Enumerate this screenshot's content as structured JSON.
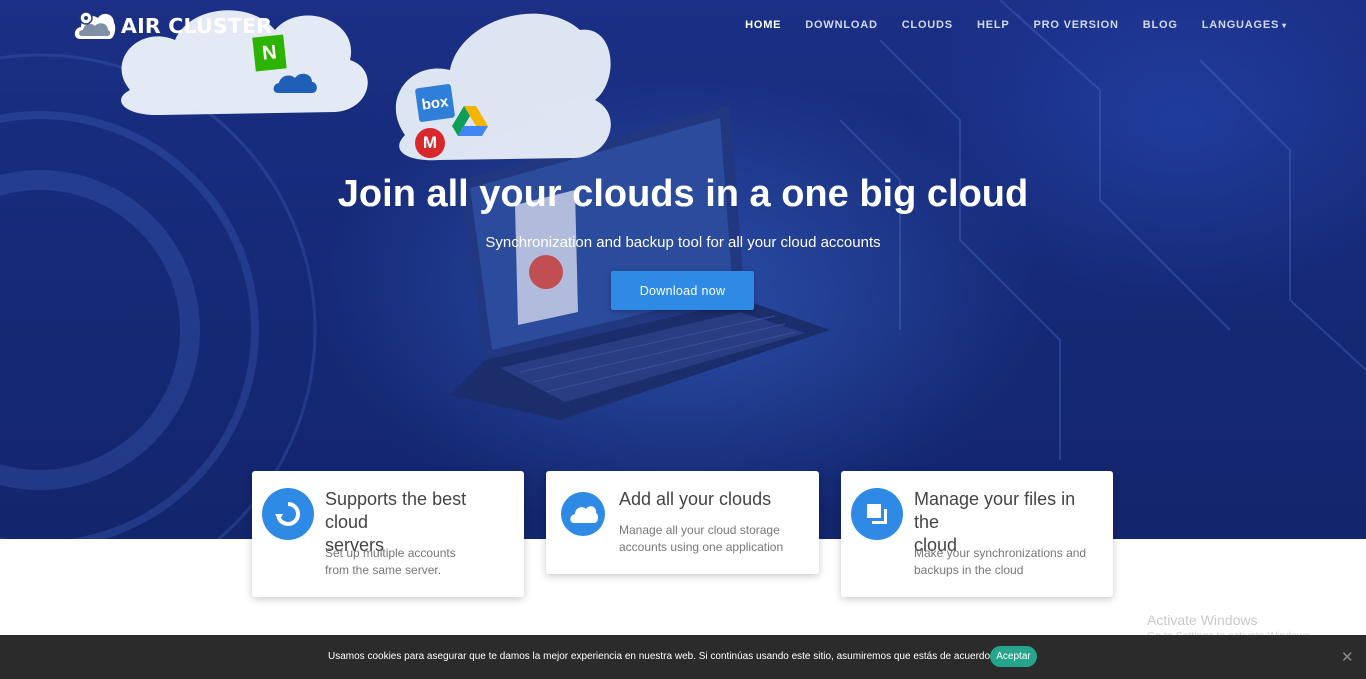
{
  "brand": {
    "name": "AIR CLUSTER",
    "logo_icon": "cloud-logo-icon"
  },
  "nav": {
    "items": [
      {
        "label": "HOME",
        "active": true
      },
      {
        "label": "DOWNLOAD",
        "active": false
      },
      {
        "label": "CLOUDS",
        "active": false
      },
      {
        "label": "HELP",
        "active": false
      },
      {
        "label": "PRO VERSION",
        "active": false
      },
      {
        "label": "BLOG",
        "active": false
      }
    ],
    "languages": {
      "label": "LANGUAGES",
      "caret": "▾"
    }
  },
  "hero": {
    "headline": "Join all your clouds in a one big cloud",
    "subheadline": "Synchronization and backup tool for all your cloud accounts",
    "cta_label": "Download now",
    "cloud_service_icons": [
      "naver-icon",
      "onedrive-icon",
      "box-icon",
      "google-drive-icon",
      "mega-icon"
    ],
    "box_text": "box",
    "naver_text": "N",
    "mega_text": "M"
  },
  "features": [
    {
      "icon": "refresh-circle-icon",
      "title_line1": "Supports the best cloud",
      "title_line2": "servers",
      "text_line1": "Set up multiple accounts",
      "text_line2": "from the same server."
    },
    {
      "icon": "cloud-icon",
      "title_line1": "Add all your clouds",
      "title_line2": "",
      "text_line1": "Manage all your cloud storage",
      "text_line2": "accounts using one application"
    },
    {
      "icon": "files-icon",
      "title_line1": "Manage your files in the",
      "title_line2": "cloud",
      "text_line1": "Make your synchronizations and",
      "text_line2": "backups in the cloud"
    }
  ],
  "os_watermark": {
    "title": "Activate Windows",
    "subtitle": "Go to Settings to activate Windows."
  },
  "cookie_banner": {
    "message": "Usamos cookies para asegurar que te damos la mejor experiencia en nuestra web. Si continúas usando este sitio, asumiremos que estás de acuerdo con ello.",
    "accept_label": "Aceptar",
    "close_symbol": "✕"
  },
  "colors": {
    "accent": "#2f8ae6",
    "hero_bg": "#1b2f86",
    "cookie_bg": "#2b2b2b",
    "accept_bg": "#25a58c"
  }
}
